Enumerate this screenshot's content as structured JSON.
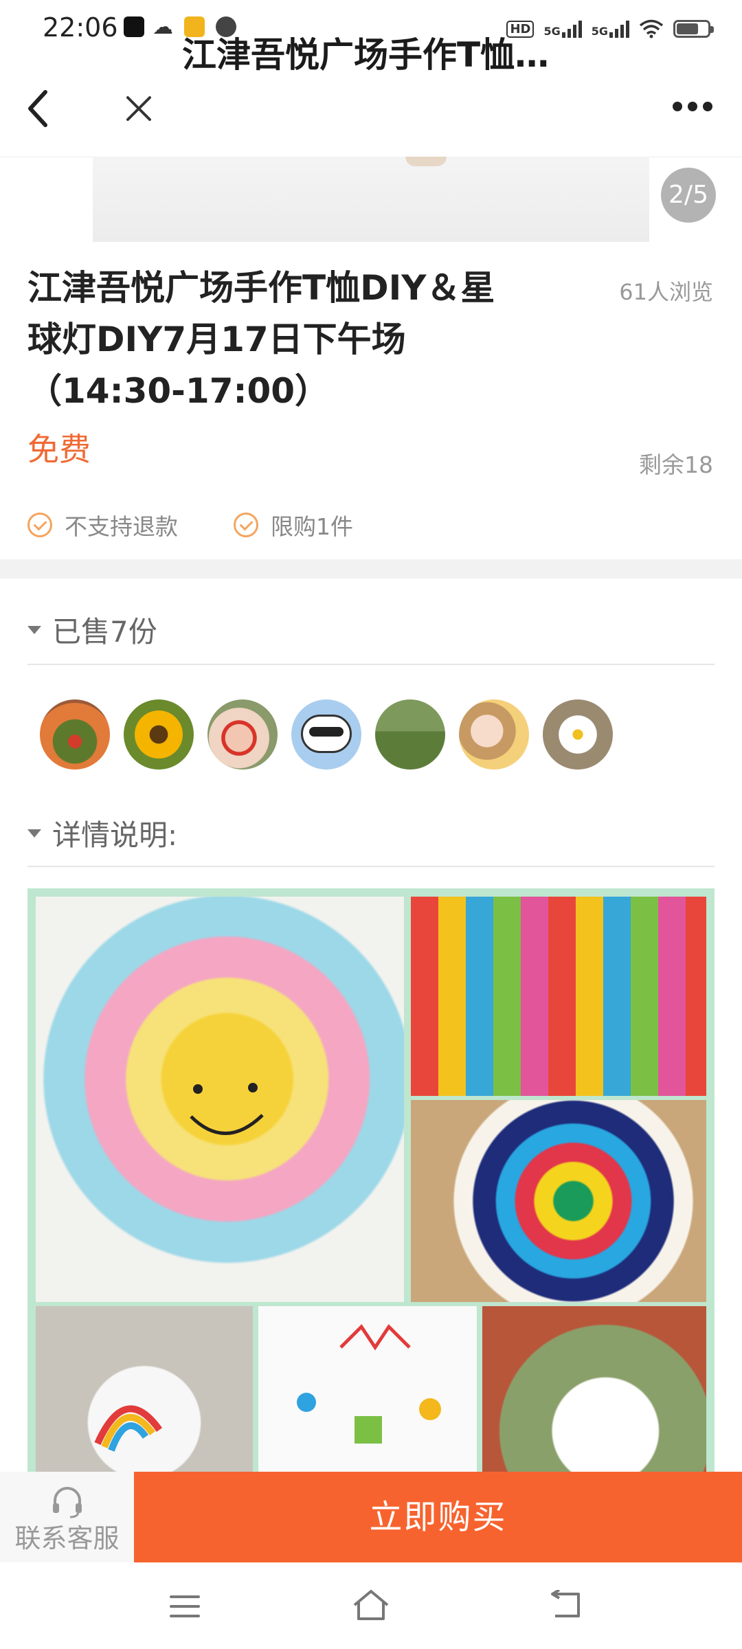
{
  "status_bar": {
    "time": "22:06",
    "hd_label": "HD",
    "signal1_label": "5G",
    "signal2_label": "5G",
    "battery_level": 0.7
  },
  "nav": {
    "title": "江津吾悦广场手作T恤…"
  },
  "gallery": {
    "page_indicator": "2/5"
  },
  "product": {
    "title": "江津吾悦广场手作T恤DIY＆星球灯DIY7月17日下午场（14:30-17:00）",
    "views": "61人浏览",
    "price": "免费",
    "remaining": "剩余18",
    "tags": [
      "不支持退款",
      "限购1件"
    ]
  },
  "sold": {
    "label": "已售7份",
    "avatar_count": 7
  },
  "details": {
    "label": "详情说明:"
  },
  "actions": {
    "customer_service": "联系客服",
    "buy": "立即购买"
  },
  "colors": {
    "accent": "#f7632e",
    "price": "#f06a35",
    "check": "#f4a45c"
  },
  "icons": [
    "back-arrow-icon",
    "close-icon",
    "more-icon",
    "headset-icon",
    "menu-icon",
    "home-icon",
    "back-icon"
  ]
}
